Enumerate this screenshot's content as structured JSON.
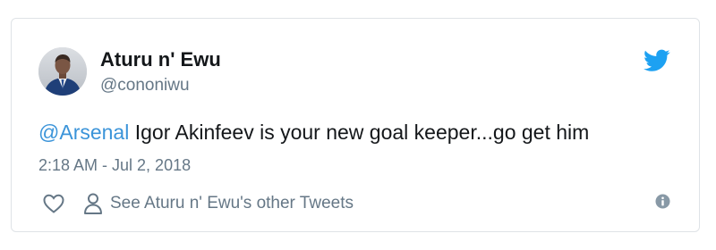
{
  "author": {
    "name": "Aturu n' Ewu",
    "handle": "@cononiwu"
  },
  "tweet": {
    "mention": "@Arsenal",
    "body": " Igor Akinfeev is your new goal keeper...go get him",
    "timestamp": "2:18 AM - Jul 2, 2018"
  },
  "footer": {
    "other_tweets_label": "See Aturu n' Ewu's other Tweets"
  },
  "icons": {
    "brand": "twitter-bird-icon",
    "like": "heart-icon",
    "profile": "person-icon",
    "info": "info-icon"
  },
  "colors": {
    "brand_blue": "#1da1f2",
    "mention_blue": "#3b94d9",
    "text_primary": "#14171a",
    "text_secondary": "#657786",
    "border": "#dfe3e7"
  }
}
